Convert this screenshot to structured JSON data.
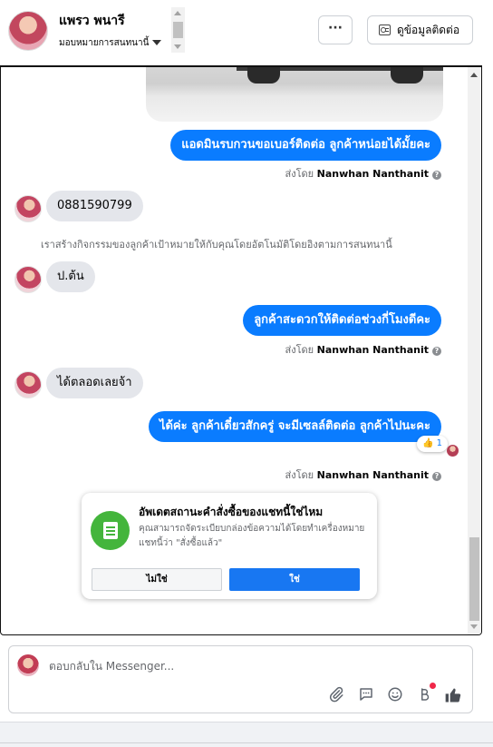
{
  "header": {
    "user_name": "แพรว พนารี",
    "assign_label": "มอบหมายการสนทนานี้",
    "more_label": "···",
    "contact_label": "ดูข้อมูลติดต่อ"
  },
  "messages": [
    {
      "id": "m1",
      "direction": "out",
      "text": "แอดมินรบกวนขอเบอร์ติดต่อ ลูกค้าหน่อยได้มั้ยคะ"
    },
    {
      "id": "m2",
      "direction": "in",
      "text": "0881590799"
    },
    {
      "id": "m3",
      "direction": "in",
      "text": "ป.ต้น"
    },
    {
      "id": "m4",
      "direction": "out",
      "text": "ลูกค้าสะดวกให้ติดต่อช่วงกี่โมงดีคะ"
    },
    {
      "id": "m5",
      "direction": "in",
      "text": "ได้ตลอดเลยจ้า"
    },
    {
      "id": "m6",
      "direction": "out",
      "text": "ได้ค่ะ ลูกค้าเดี๋ยวสักครู่ จะมีเซลล์ติดต่อ ลูกค้าไปนะคะ"
    }
  ],
  "sent_by_prefix": "ส่งโดย",
  "sent_by_name": "Nanwhan Nanthanit",
  "info_glyph": "?",
  "system_note": "เราสร้างกิจกรรมของลูกค้าเป้าหมายให้กับคุณโดยอัตโนมัติโดยอิงตามการสนทนานี้",
  "reaction": {
    "emoji": "👍",
    "count": "1"
  },
  "status_card": {
    "title": "อัพเดตสถานะคำสั่งซื้อของแชทนี้ใช่ไหม",
    "description": "คุณสามารถจัดระเบียบกล่องข้อความได้โดยทำเครื่องหมายแชทนี้ว่า \"สั่งซื้อแล้ว\"",
    "no_label": "ไม่ใช่",
    "yes_label": "ใช่"
  },
  "composer": {
    "placeholder": "ตอบกลับใน Messenger...",
    "icons": [
      "paperclip-icon",
      "saved-reply-icon",
      "emoji-icon",
      "payment-icon",
      "like-icon"
    ]
  },
  "colors": {
    "outgoing_bubble": "#0a7cff",
    "incoming_bubble": "#e4e6eb",
    "primary_button": "#1877f2",
    "status_icon": "#44b53c"
  }
}
